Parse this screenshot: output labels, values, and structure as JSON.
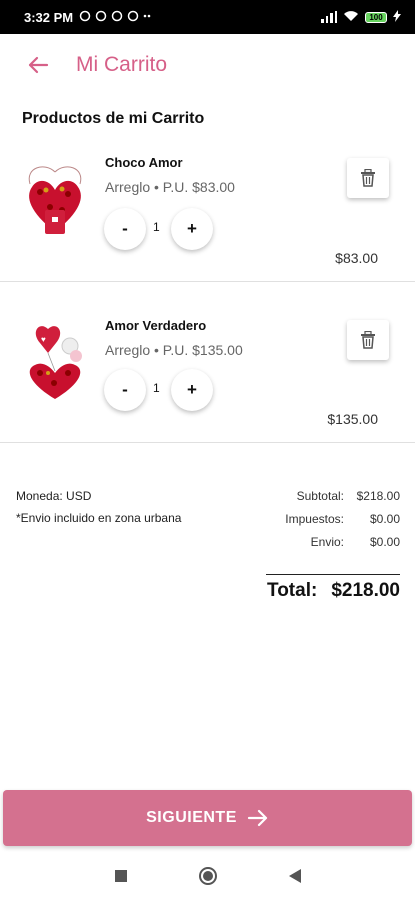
{
  "status_bar": {
    "time": "3:32 PM",
    "battery": "100"
  },
  "header": {
    "title": "Mi Carrito"
  },
  "section_title": "Productos de mi Carrito",
  "products": [
    {
      "name": "Choco Amor",
      "desc": "Arreglo • P.U. $83.00",
      "qty": "1",
      "price": "$83.00",
      "minus": "-",
      "plus": "+"
    },
    {
      "name": "Amor Verdadero",
      "desc": "Arreglo • P.U. $135.00",
      "qty": "1",
      "price": "$135.00",
      "minus": "-",
      "plus": "+"
    }
  ],
  "summary": {
    "currency": "Moneda: USD",
    "shipping_note": "*Envio incluido en zona urbana",
    "rows": [
      {
        "label": "Subtotal:",
        "value": "$218.00"
      },
      {
        "label": "Impuestos:",
        "value": "$0.00"
      },
      {
        "label": "Envio:",
        "value": "$0.00"
      }
    ],
    "total_label": "Total:",
    "total_value": "$218.00"
  },
  "next_button": {
    "label": "SIGUIENTE"
  },
  "colors": {
    "accent": "#d66088",
    "button": "#d4718f"
  }
}
